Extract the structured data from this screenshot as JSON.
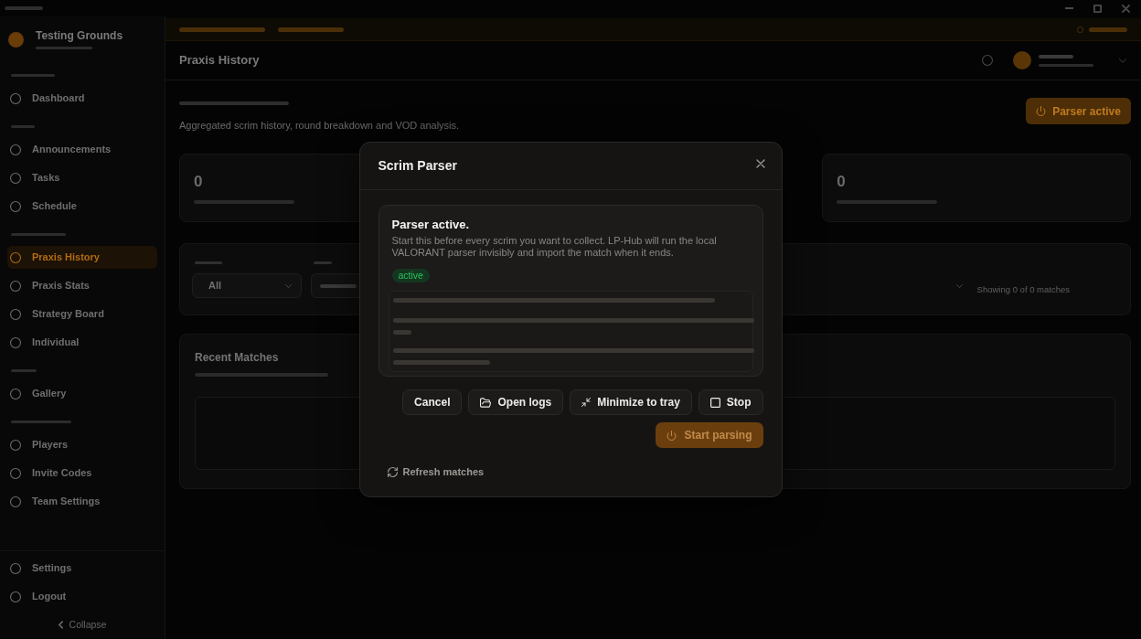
{
  "sidebar": {
    "team": {
      "name": "Testing Grounds"
    },
    "sections": [
      {
        "items": [
          {
            "label": "Dashboard",
            "selected": false
          }
        ]
      },
      {
        "items": [
          {
            "label": "Announcements",
            "selected": false
          },
          {
            "label": "Tasks",
            "selected": false
          },
          {
            "label": "Schedule",
            "selected": false
          }
        ]
      },
      {
        "items": [
          {
            "label": "Praxis History",
            "selected": true
          },
          {
            "label": "Praxis Stats",
            "selected": false
          },
          {
            "label": "Strategy Board",
            "selected": false
          },
          {
            "label": "Individual",
            "selected": false
          }
        ]
      },
      {
        "items": [
          {
            "label": "Gallery",
            "selected": false
          }
        ]
      },
      {
        "items": [
          {
            "label": "Players",
            "selected": false
          },
          {
            "label": "Invite Codes",
            "selected": false
          },
          {
            "label": "Team Settings",
            "selected": false
          }
        ]
      }
    ],
    "footer_items": [
      {
        "label": "Settings"
      },
      {
        "label": "Logout"
      }
    ],
    "collapse": {
      "label": "Collapse"
    }
  },
  "header": {
    "title": "Praxis History"
  },
  "page": {
    "subtitle": "Aggregated scrim history, round breakdown and VOD analysis.",
    "parser_button": {
      "label": "Parser active"
    },
    "stats": [
      {
        "value": "0"
      },
      {
        "value": "0"
      }
    ],
    "filter": {
      "select_value": "All",
      "result": "Showing 0 of 0 matches"
    },
    "recent": {
      "title": "Recent Matches"
    }
  },
  "modal": {
    "title": "Scrim Parser",
    "status": {
      "title": "Parser active.",
      "description": "Start this before every scrim you want to collect. LP-Hub will run the local VALORANT parser invisibly and import the match when it ends.",
      "badge": "active"
    },
    "actions": [
      {
        "kind": "cancel",
        "label": "Cancel"
      },
      {
        "kind": "open_logs",
        "label": "Open logs"
      },
      {
        "kind": "minimize",
        "label": "Minimize to tray"
      },
      {
        "kind": "stop",
        "label": "Stop"
      }
    ],
    "primary": {
      "label": "Start parsing",
      "disabled": true
    },
    "refresh": {
      "label": "Refresh matches"
    }
  }
}
